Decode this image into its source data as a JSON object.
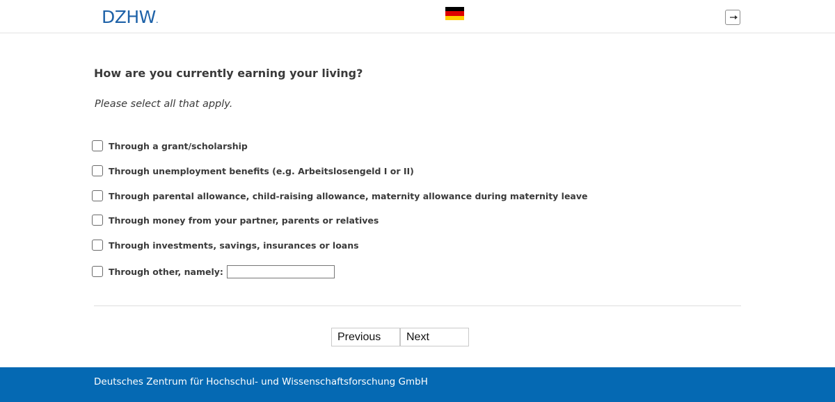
{
  "header": {
    "logo_text": "DZHW",
    "logo_dot": ".",
    "flag_colors": [
      "#000000",
      "#dd0000",
      "#ffce00"
    ],
    "logout_icon": "logout-icon"
  },
  "question": {
    "title": "How are you currently earning your living?",
    "instruction": "Please select all that apply."
  },
  "options": [
    {
      "label": "Through a grant/scholarship",
      "checked": false
    },
    {
      "label": "Through unemployment benefits (e.g. Arbeitslosengeld I or II)",
      "checked": false
    },
    {
      "label": "Through parental allowance, child-raising allowance, maternity allowance during maternity leave",
      "checked": false
    },
    {
      "label": "Through money from your partner, parents or relatives",
      "checked": false
    },
    {
      "label": "Through investments, savings, insurances or loans",
      "checked": false
    },
    {
      "label": "Through other, namely:",
      "checked": false,
      "input_value": ""
    }
  ],
  "navigation": {
    "previous_label": "Previous",
    "next_label": "Next"
  },
  "footer": {
    "text": "Deutsches Zentrum für Hochschul- und Wissenschaftsforschung GmbH"
  },
  "colors": {
    "brand_blue": "#1e62a8",
    "footer_blue": "#0569b3"
  }
}
